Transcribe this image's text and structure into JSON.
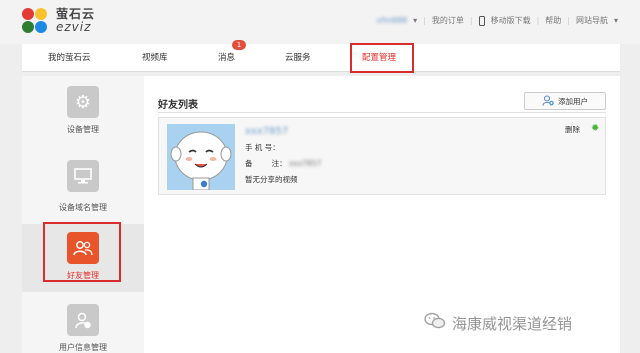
{
  "brand": {
    "name_cn": "萤石云",
    "name_en": "ezviz",
    "colors": [
      "#e53935",
      "#2e7d32",
      "#1e88e5",
      "#fbc02d"
    ]
  },
  "topnav": {
    "user": "xfm888",
    "orders": "我的订单",
    "mobile": "移动版下载",
    "help": "帮助",
    "sitemap": "网站导航"
  },
  "tabs": [
    {
      "label": "我的萤石云"
    },
    {
      "label": "视频库"
    },
    {
      "label": "消息",
      "badge": "1"
    },
    {
      "label": "云服务"
    },
    {
      "label": "配置管理",
      "active": true
    }
  ],
  "sidebar": {
    "items": [
      {
        "label": "设备管理",
        "icon": "gear-icon"
      },
      {
        "label": "设备域名管理",
        "icon": "monitor-icon"
      },
      {
        "label": "好友管理",
        "icon": "users-icon",
        "active": true
      },
      {
        "label": "用户信息管理",
        "icon": "user-info-icon"
      }
    ]
  },
  "main": {
    "title": "好友列表",
    "add_button": "添加用户",
    "friend": {
      "name": "xxx7857",
      "phone_label": "手 机 号：",
      "note_label": "备        注：",
      "note_value": "xxx7857",
      "videos": "暂无分享的视频",
      "delete": "删除"
    }
  },
  "watermark": "海康威视渠道经销",
  "accent_color": "#e2302a"
}
